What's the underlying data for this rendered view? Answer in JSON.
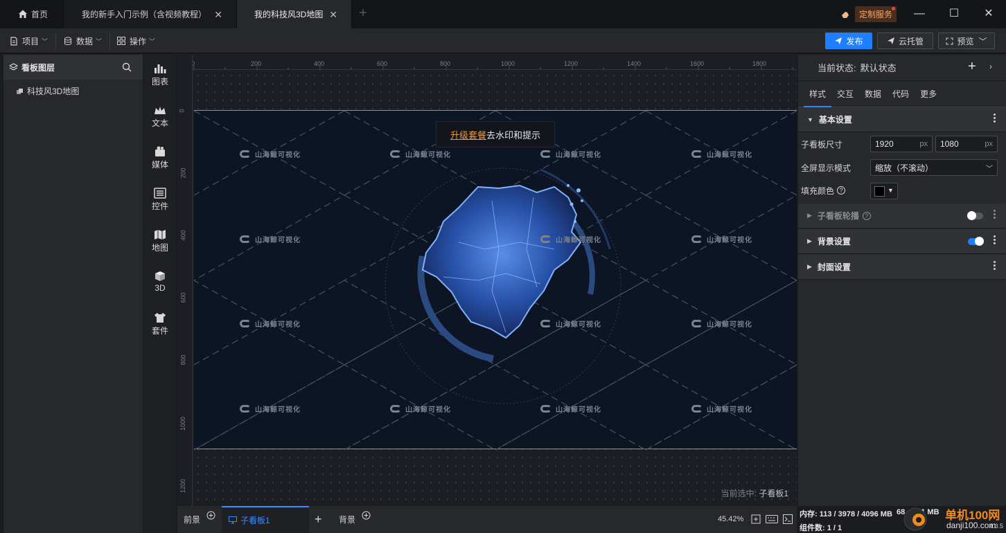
{
  "tabs": {
    "home": "首页",
    "tab1": "我的新手入门示例（含视频教程）",
    "tab2": "我的科技风3D地图"
  },
  "custom_service": "定制服务",
  "menu": {
    "project": "项目",
    "data": "数据",
    "operate": "操作",
    "publish": "发布",
    "cloud": "云托管",
    "preview": "预览"
  },
  "layers": {
    "title": "看板图层",
    "items": [
      {
        "label": "科技风3D地图"
      }
    ]
  },
  "components": [
    {
      "label": "图表",
      "icon": "chart-icon"
    },
    {
      "label": "文本",
      "icon": "text-icon"
    },
    {
      "label": "媒体",
      "icon": "media-icon"
    },
    {
      "label": "控件",
      "icon": "control-icon"
    },
    {
      "label": "地图",
      "icon": "map-icon"
    },
    {
      "label": "3D",
      "icon": "cube-icon"
    },
    {
      "label": "套件",
      "icon": "kit-icon"
    }
  ],
  "ruler": {
    "h": [
      "0",
      "200",
      "400",
      "600",
      "800",
      "1000",
      "1200",
      "1400",
      "1600",
      "1800"
    ],
    "v": [
      "0",
      "200",
      "400",
      "600",
      "800",
      "1000",
      "1200"
    ]
  },
  "canvas": {
    "upgrade_link": "升级套餐",
    "upgrade_rest": "去水印和提示",
    "watermark": "山海鲸可视化",
    "selected_prefix": "当前选中:",
    "selected_name": "子看板1"
  },
  "bottom": {
    "front": "前景",
    "sub": "子看板1",
    "back": "背景",
    "zoom": "45.42%"
  },
  "right": {
    "state_label": "当前状态:",
    "state_value": "默认状态",
    "tabs": [
      "样式",
      "交互",
      "数据",
      "代码",
      "更多"
    ],
    "basic": "基本设置",
    "size_label": "子看板尺寸",
    "width": "1920",
    "height": "1080",
    "unit": "px",
    "fullscreen_label": "全屏显示模式",
    "fullscreen_value": "缩放（不滚动）",
    "fill_label": "填充颜色",
    "carousel": "子看板轮播",
    "background": "背景设置",
    "cover": "封面设置"
  },
  "status": {
    "memory": "内存:  113 / 3978 / 4096 MB",
    "fps": "68",
    "mem2": "181 MB",
    "components": "组件数: 1 / 1",
    "version": "4.3.5",
    "site_cn": "单机100网",
    "site_url": "danji100.com"
  },
  "colors": {
    "accent": "#1e80ff",
    "orange": "#ef9a3c",
    "board_bg": "#0d1424"
  }
}
